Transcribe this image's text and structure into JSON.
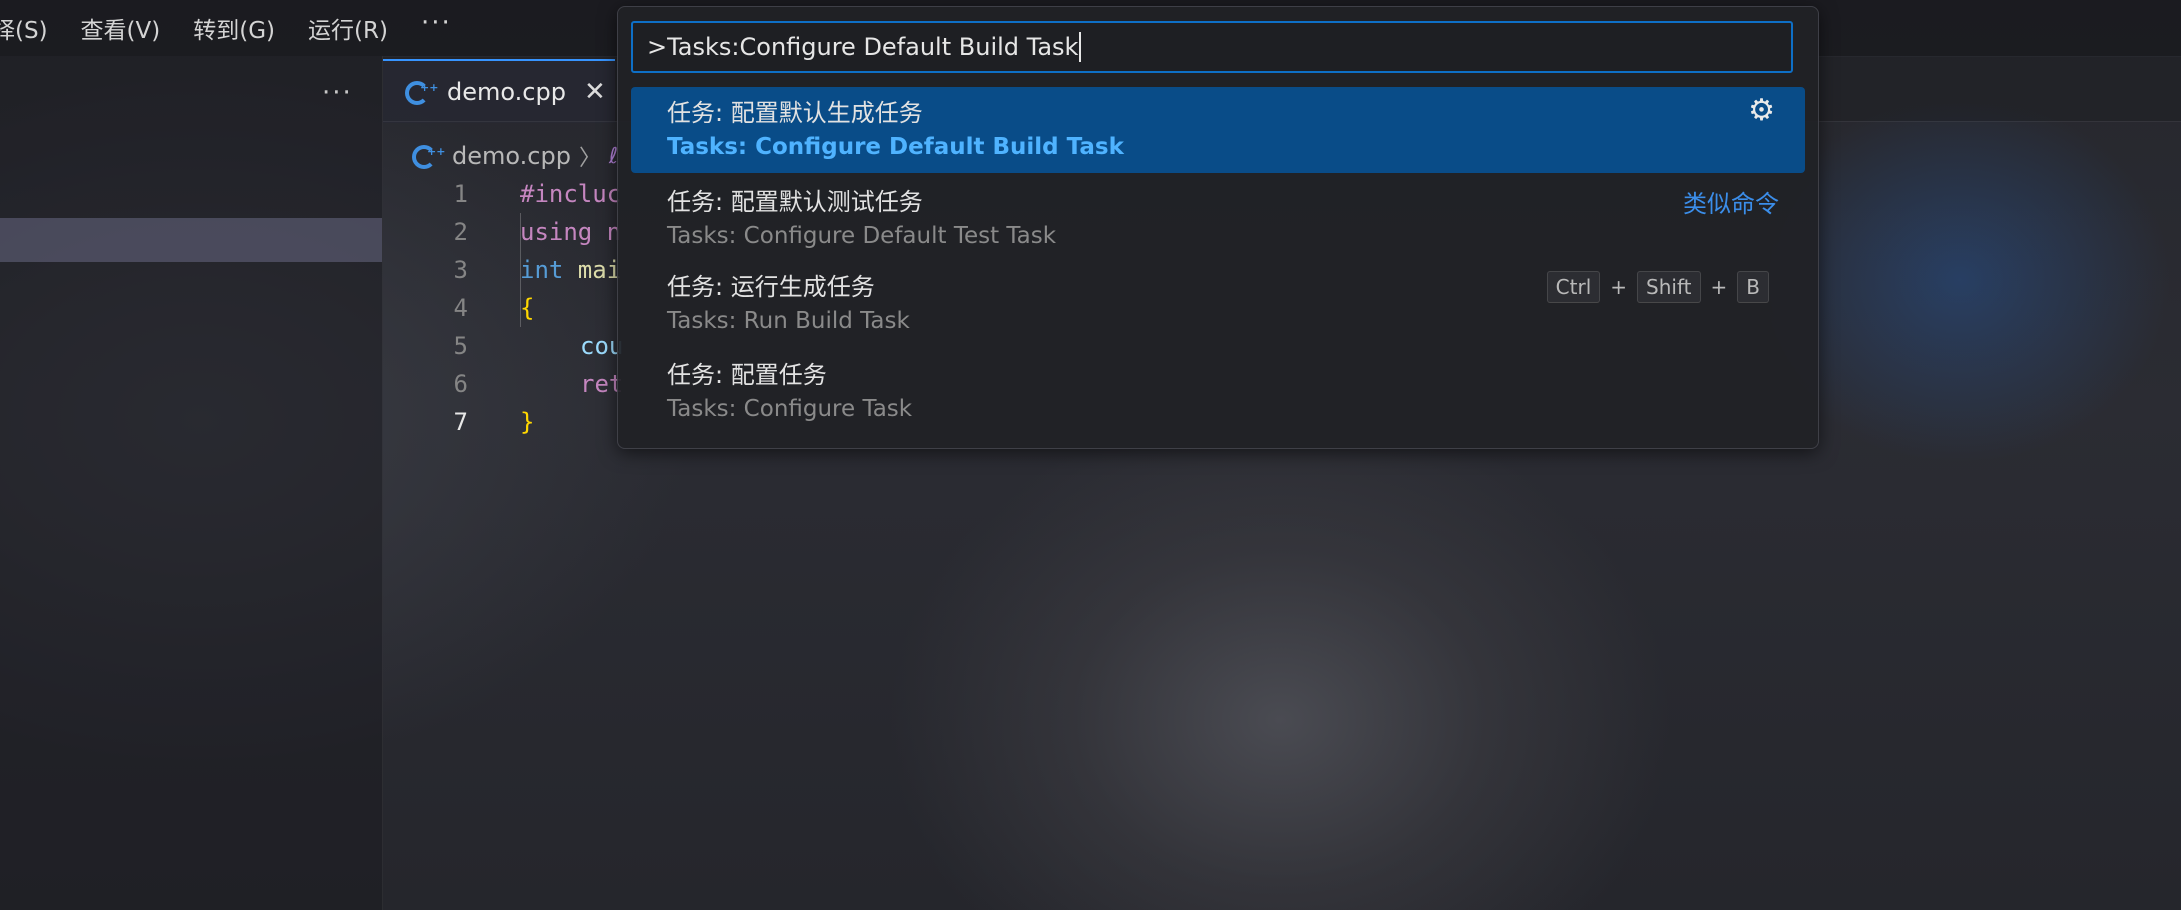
{
  "menu": {
    "items": [
      "择(S)",
      "查看(V)",
      "转到(G)",
      "运行(R)"
    ],
    "more": "···"
  },
  "sidebar": {
    "more": "···"
  },
  "editor": {
    "tab": {
      "label": "demo.cpp",
      "close": "✕",
      "icon": "cpp-file-icon"
    },
    "breadcrumb": {
      "file": "demo.cpp",
      "separator": "〉",
      "symbol": "ℓ"
    },
    "lines": [
      {
        "number": "1",
        "text": "#incluc"
      },
      {
        "number": "2",
        "kw": "using",
        "rest": " n"
      },
      {
        "number": "3",
        "kw": "int",
        "fn": " mai"
      },
      {
        "number": "4",
        "text": "{"
      },
      {
        "number": "5",
        "text": "cou"
      },
      {
        "number": "6",
        "text": "ret"
      },
      {
        "number": "7",
        "text": "}"
      }
    ]
  },
  "palette": {
    "prefix": ">",
    "query": "Tasks:Configure Default Build Task",
    "results": [
      {
        "label": "任务: 配置默认生成任务",
        "detail": "Tasks: Configure Default Build Task",
        "action_icon": "gear-icon",
        "action_glyph": "⚙"
      },
      {
        "label": "任务: 配置默认测试任务",
        "detail": "Tasks: Configure Default Test Task",
        "hint": "类似命令"
      },
      {
        "label": "任务: 运行生成任务",
        "detail": "Tasks: Run Build Task",
        "keys": [
          "Ctrl",
          "Shift",
          "B"
        ],
        "plus": "+"
      },
      {
        "label": "任务: 配置任务",
        "detail": "Tasks: Configure Task"
      }
    ]
  },
  "colors": {
    "accent": "#0e6fc6",
    "selection": "#06529a",
    "link": "#3b8eea"
  }
}
